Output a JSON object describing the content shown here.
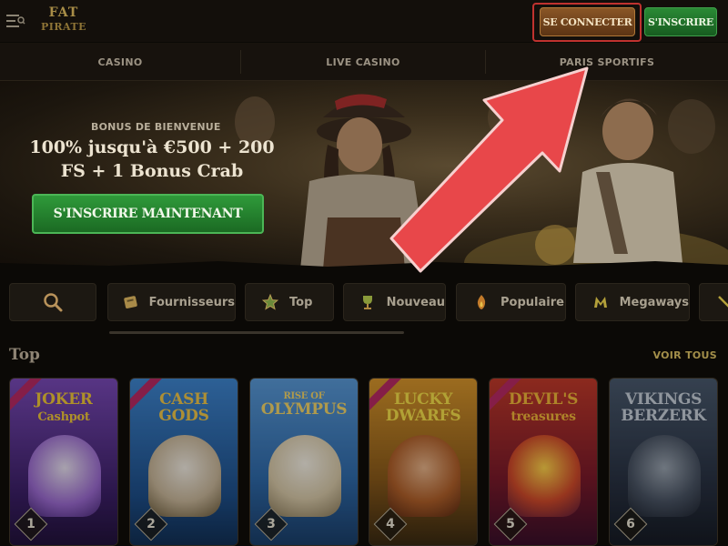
{
  "header": {
    "logo_line1": "FAT",
    "logo_line2": "PIRATE",
    "login_label": "SE CONNECTER",
    "register_label": "S'INSCRIRE"
  },
  "nav": {
    "tabs": [
      {
        "label": "CASINO"
      },
      {
        "label": "LIVE CASINO"
      },
      {
        "label": "PARIS SPORTIFS"
      }
    ]
  },
  "hero": {
    "subtitle": "BONUS DE BIENVENUE",
    "title": "100% jusqu'à €500 + 200 FS + 1 Bonus Crab",
    "cta_label": "S'INSCRIRE MAINTENANT"
  },
  "chips": {
    "search_icon": "search-icon",
    "items": [
      {
        "label": "Fournisseurs",
        "icon": "providers-icon"
      },
      {
        "label": "Top",
        "icon": "star-icon"
      },
      {
        "label": "Nouveau",
        "icon": "trophy-icon"
      },
      {
        "label": "Populaire",
        "icon": "fire-icon"
      },
      {
        "label": "Megaways",
        "icon": "megaways-icon"
      }
    ]
  },
  "section": {
    "title": "Top",
    "view_all": "VOIR TOUS"
  },
  "games": [
    {
      "rank": "1",
      "title_small": "",
      "title": "JOKER",
      "title2": "Cashpot",
      "color": "#6f3fb0"
    },
    {
      "rank": "2",
      "title_small": "",
      "title": "CASH",
      "title2": "GODS",
      "color": "#2f6fb6"
    },
    {
      "rank": "3",
      "title_small": "RISE OF",
      "title": "OLYMPUS",
      "title2": "",
      "color": "#3a78b8"
    },
    {
      "rank": "4",
      "title_small": "",
      "title": "LUCKY",
      "title2": "DWARFS",
      "color": "#c27a1e"
    },
    {
      "rank": "5",
      "title_small": "",
      "title": "DEVIL'S",
      "title2": "treasures",
      "color": "#b0302e"
    },
    {
      "rank": "6",
      "title_small": "",
      "title": "VIKINGS",
      "title2": "BERZERK",
      "color": "#3d4a5c"
    }
  ],
  "colors": {
    "login_highlight": "#c0322f",
    "arrow": "#e8474a",
    "register_green": "#2a8a35",
    "accent_gold": "#a38f4a"
  }
}
